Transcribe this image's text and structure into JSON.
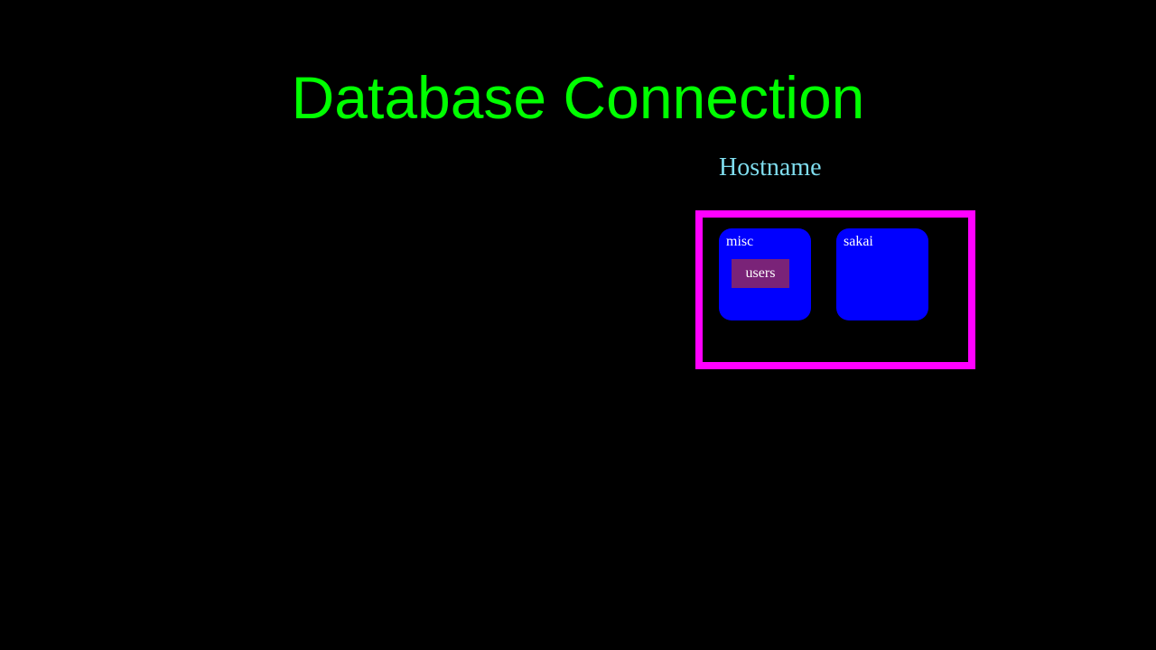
{
  "title": "Database Connection",
  "hostname_label": "Hostname",
  "databases": [
    {
      "name": "misc",
      "tables": [
        "users"
      ]
    },
    {
      "name": "sakai",
      "tables": []
    }
  ]
}
